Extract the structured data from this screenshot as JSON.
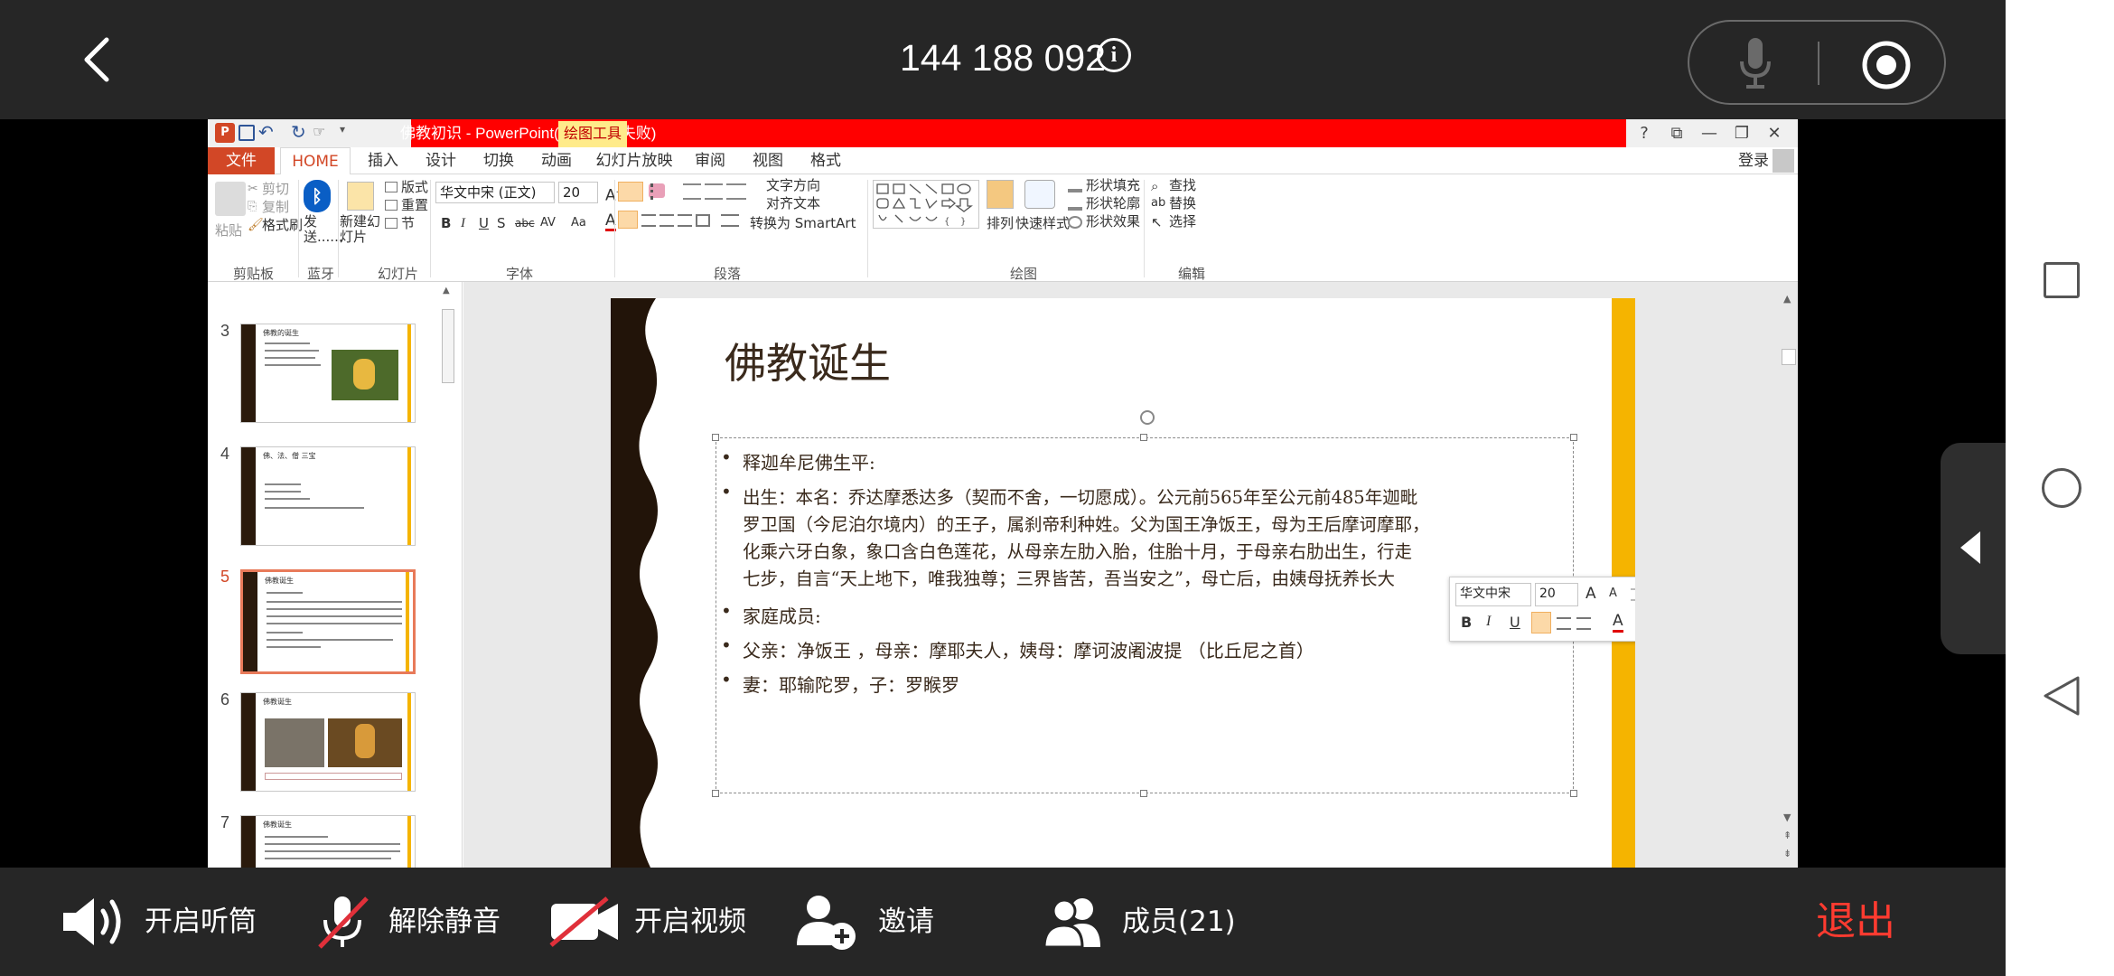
{
  "meeting": {
    "id": "144 188 092",
    "info_icon_glyph": "i"
  },
  "ppt": {
    "window_title": "佛教初识 - PowerPoint(产品激活失败)",
    "context_tab": "绘图工具",
    "window_buttons": [
      "?",
      "⧉",
      "—",
      "❐",
      "✕"
    ],
    "login": "登录",
    "tabs": [
      "文件",
      "HOME",
      "插入",
      "设计",
      "切换",
      "动画",
      "幻灯片放映",
      "审阅",
      "视图",
      "格式"
    ],
    "ribbon": {
      "clipboard": {
        "paste": "粘贴",
        "cut": "剪切",
        "copy": "复制",
        "format_painter": "格式刷",
        "group": "剪贴板"
      },
      "bluetooth": {
        "send": "发送......",
        "group": "蓝牙"
      },
      "slides": {
        "new_slide": "新建幻灯片",
        "layout": "版式",
        "reset": "重置",
        "section": "节",
        "group": "幻灯片"
      },
      "font": {
        "name": "华文中宋 (正文)",
        "size": "20",
        "group": "字体",
        "buttons": [
          "B",
          "I",
          "U",
          "S",
          "abc",
          "AV",
          "Aa",
          "A"
        ]
      },
      "paragraph": {
        "text_direction": "文字方向",
        "align_text": "对齐文本",
        "smartart": "转换为 SmartArt",
        "group": "段落"
      },
      "drawing": {
        "arrange": "排列",
        "quick_styles": "快速样式",
        "shape_fill": "形状填充",
        "shape_outline": "形状轮廓",
        "shape_effects": "形状效果",
        "group": "绘图"
      },
      "editing": {
        "find": "查找",
        "replace": "替换",
        "select": "选择",
        "group": "编辑"
      }
    },
    "thumbnails": [
      {
        "num": "3",
        "title": "佛教的诞生"
      },
      {
        "num": "4",
        "title": "佛、法、僧 三宝"
      },
      {
        "num": "5",
        "title": "佛教诞生"
      },
      {
        "num": "6",
        "title": "佛教诞生"
      },
      {
        "num": "7",
        "title": "佛教诞生"
      }
    ],
    "slide": {
      "title": "佛教诞生",
      "bullets": [
        {
          "line1": "释迦牟尼佛生平:"
        },
        {
          "line1": "出生：本名：乔达摩悉达多（契而不舍，一切愿成）。公元前565年至公元前485年迦毗",
          "line2": "罗卫国（今尼泊尔境内）的王子，属刹帝利种姓。父为国王净饭王，母为王后摩诃摩耶，",
          "line3": "化乘六牙白象，象口含白色莲花，从母亲左肋入胎，住胎十月，于母亲右肋出生，行走",
          "line4": "七步，自言“天上地下，唯我独尊；三界皆苦，吾当安之”，母亡后，由姨母抚养长大"
        },
        {
          "line1": "家庭成员:"
        },
        {
          "line1": "父亲：净饭王 ，母亲：摩耶夫人，姨母：摩诃波阇波提 （比丘尼之首）"
        },
        {
          "line1": "妻：耶输陀罗，子：罗睺罗"
        }
      ]
    },
    "mini_toolbar": {
      "font": "华文中宋",
      "size": "20",
      "grow": "A",
      "shrink": "A",
      "bold": "B",
      "italic": "I",
      "underline": "U",
      "font_color": "A"
    }
  },
  "bottom": {
    "speaker": "开启听筒",
    "unmute": "解除静音",
    "video": "开启视频",
    "invite": "邀请",
    "members": "成员(21)",
    "exit": "退出"
  },
  "colors": {
    "accent_red": "#ff0000",
    "file_tab": "#d24726",
    "slide_yellow": "#f5b400",
    "exit_red": "#ff3b30"
  }
}
